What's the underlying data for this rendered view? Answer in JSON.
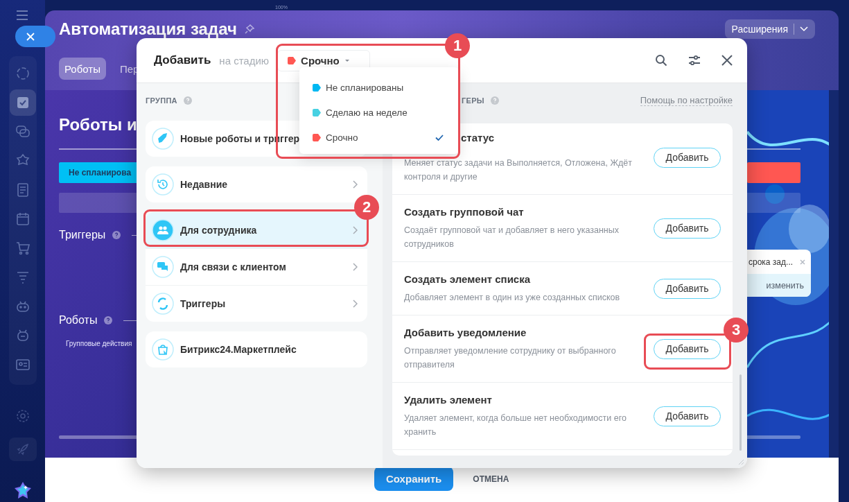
{
  "top_bar": {
    "zoom": "100%"
  },
  "page": {
    "title": "Автоматизация задач",
    "tabs": [
      {
        "label": "Роботы",
        "selected": true
      },
      {
        "label": "Пер",
        "selected": false
      }
    ],
    "extensions_button": "Расширения",
    "heading": "Роботы и",
    "stages": [
      {
        "label": "Не спланирова",
        "color": "#00c0f5"
      },
      {
        "color": "#ff5752"
      }
    ],
    "sections": [
      {
        "label": "Триггеры"
      },
      {
        "label": "Роботы"
      }
    ],
    "group_actions": "Групповые действия",
    "toast": {
      "text": "срока зад...",
      "action": "изменить"
    },
    "footer": {
      "save": "Сохранить",
      "cancel": "ОТМЕНА"
    }
  },
  "dialog": {
    "title": "Добавить",
    "stage_prefix": "на стадию",
    "stage": {
      "label": "Срочно",
      "color": "#ff5752"
    },
    "stage_menu": [
      {
        "label": "Не спланированы",
        "color": "#00b8f2",
        "selected": false
      },
      {
        "label": "Сделаю на неделе",
        "color": "#47d1e2",
        "selected": false
      },
      {
        "label": "Срочно",
        "color": "#ff5752",
        "selected": true
      }
    ],
    "group_header": "ГРУППА",
    "groups": [
      {
        "items": [
          {
            "label": "Новые роботы и триггер",
            "selected": false,
            "has_arrow": false
          }
        ]
      },
      {
        "items": [
          {
            "label": "Недавние",
            "selected": false,
            "has_arrow": true
          }
        ]
      },
      {
        "items": [
          {
            "label": "Для сотрудника",
            "selected": true,
            "has_arrow": true
          },
          {
            "label": "Для связи с клиентом",
            "selected": false,
            "has_arrow": true
          },
          {
            "label": "Триггеры",
            "selected": false,
            "has_arrow": true
          }
        ]
      },
      {
        "items": [
          {
            "label": "Битрикс24.Маркетплейс",
            "selected": false,
            "has_arrow": false
          }
        ]
      }
    ],
    "list_header": "ГЕРЫ",
    "help_link": "Помощь по настройке",
    "robots": [
      {
        "title": "статус",
        "description": "Меняет статус задачи на Выполняется, Отложена, Ждёт контроля и другие",
        "button": "Добавить"
      },
      {
        "title": "Создать групповой чат",
        "description": "Создаёт групповой чат и добавляет в него указанных сотрудников",
        "button": "Добавить"
      },
      {
        "title": "Создать элемент списка",
        "description": "Добавляет элемент в один из уже созданных списков",
        "button": "Добавить"
      },
      {
        "title": "Добавить уведомление",
        "description": "Отправляет уведомление сотруднику от выбранного отправителя",
        "button": "Добавить"
      },
      {
        "title": "Удалить элемент",
        "description": "Удаляет элемент, когда больше нет необходимости его хранить",
        "button": "Добавить"
      }
    ]
  },
  "annotations": [
    {
      "number": "1"
    },
    {
      "number": "2"
    },
    {
      "number": "3"
    }
  ]
}
